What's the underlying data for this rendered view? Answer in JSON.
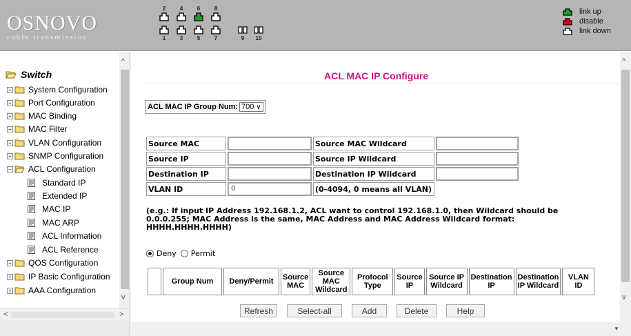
{
  "header": {
    "logo": "OSNOVO",
    "logo_sub": "cable transmission",
    "ports_top": [
      "2",
      "4",
      "6",
      "8"
    ],
    "ports_bottom": [
      "1",
      "3",
      "5",
      "7"
    ],
    "ports_fiber": [
      "9",
      "10"
    ],
    "legend": [
      {
        "label": "link up",
        "color": "#1fa01f"
      },
      {
        "label": "disable",
        "color": "#e00000"
      },
      {
        "label": "link down",
        "color": "#ffffff"
      }
    ]
  },
  "sidebar": {
    "root": "Switch",
    "items": [
      "System Configuration",
      "Port Configuration",
      "MAC Binding",
      "MAC Filter",
      "VLAN Configuration",
      "SNMP Configuration",
      "ACL Configuration",
      "QOS Configuration",
      "IP Basic Configuration",
      "AAA Configuration"
    ],
    "acl_children": [
      "Standard IP",
      "Extended IP",
      "MAC IP",
      "MAC ARP",
      "ACL Information",
      "ACL Reference"
    ]
  },
  "main": {
    "title": "ACL MAC IP Configure",
    "group_label": "ACL MAC IP Group Num:",
    "group_value": "700",
    "fields": {
      "source_mac": "Source MAC",
      "source_mac_wildcard": "Source MAC Wildcard",
      "source_ip": "Source IP",
      "source_ip_wildcard": "Source IP Wildcard",
      "destination_ip": "Destination IP",
      "destination_ip_wildcard": "Destination IP Wildcard",
      "vlan_id": "VLAN ID",
      "vlan_value": "0",
      "vlan_hint": "(0-4094, 0 means all VLAN)"
    },
    "note": "(e.g.: If input IP Address 192.168.1.2, ACL want to control 192.168.1.0, then Wildcard should be 0.0.0.255; MAC Address is the same, MAC Address and MAC Address Wildcard format: HHHH.HHHH.HHHH)",
    "deny_label": "Deny",
    "permit_label": "Permit",
    "table_headers": [
      "",
      "Group Num",
      "Deny/Permit",
      "Source MAC",
      "Source MAC Wildcard",
      "Protocol Type",
      "Source IP",
      "Source IP Wildcard",
      "Destination IP",
      "Destination IP Wildcard",
      "VLAN ID"
    ],
    "buttons": {
      "refresh": "Refresh",
      "select_all": "Select-all",
      "add": "Add",
      "delete": "Delete",
      "help": "Help"
    }
  }
}
